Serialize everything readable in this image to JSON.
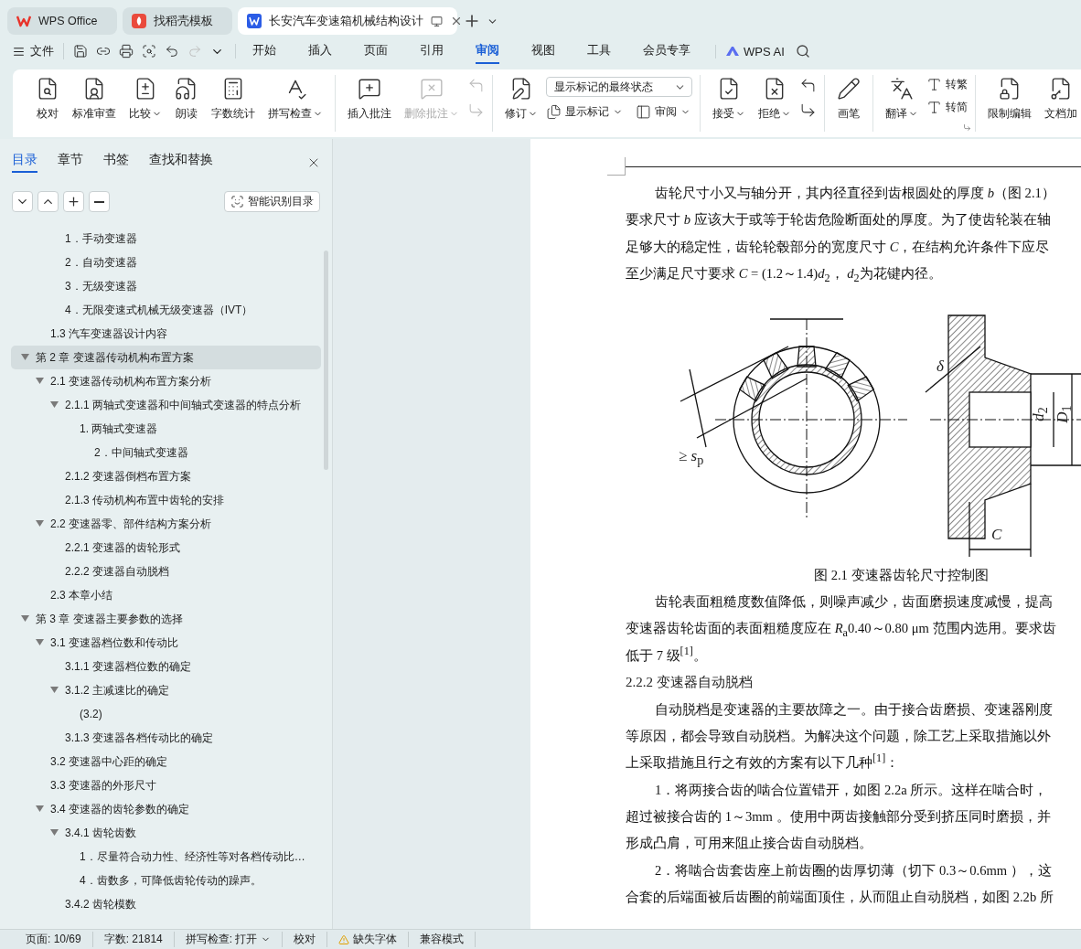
{
  "tabs": [
    {
      "label": "WPS Office",
      "selected": false,
      "kind": "wps"
    },
    {
      "label": "找稻壳模板",
      "selected": false,
      "kind": "docer"
    },
    {
      "label": "长安汽车变速箱机械结构设计",
      "selected": true,
      "kind": "doc"
    }
  ],
  "menu": {
    "file": "文件",
    "items": [
      {
        "label": "开始",
        "selected": false
      },
      {
        "label": "插入",
        "selected": false
      },
      {
        "label": "页面",
        "selected": false
      },
      {
        "label": "引用",
        "selected": false
      },
      {
        "label": "审阅",
        "selected": true
      },
      {
        "label": "视图",
        "selected": false
      },
      {
        "label": "工具",
        "selected": false
      },
      {
        "label": "会员专享",
        "selected": false
      }
    ],
    "ai": "WPS AI"
  },
  "ribbon": [
    {
      "items": [
        {
          "kind": "large",
          "label": "校对",
          "dropdown": false,
          "disabled": false
        },
        {
          "kind": "large",
          "label": "标准审查",
          "dropdown": false,
          "disabled": false
        },
        {
          "kind": "large",
          "label": "比较",
          "dropdown": true,
          "disabled": false
        },
        {
          "kind": "large",
          "label": "朗读",
          "dropdown": false,
          "disabled": false
        },
        {
          "kind": "large",
          "label": "字数统计",
          "dropdown": false,
          "disabled": false
        },
        {
          "kind": "large",
          "label": "拼写检查",
          "dropdown": true,
          "disabled": false
        }
      ]
    },
    {
      "items": [
        {
          "kind": "large",
          "label": "插入批注",
          "dropdown": false,
          "disabled": false
        },
        {
          "kind": "large",
          "label": "删除批注",
          "dropdown": true,
          "disabled": true
        },
        {
          "kind": "stack",
          "items": [
            {
              "kind": "icon",
              "disabled": true
            },
            {
              "kind": "icon",
              "disabled": true
            }
          ]
        }
      ]
    },
    {
      "items": [
        {
          "kind": "large",
          "label": "修订",
          "dropdown": true,
          "disabled": false
        },
        {
          "kind": "stack",
          "items": [
            {
              "kind": "select",
              "value": "显示标记的最终状态"
            },
            {
              "kind": "row",
              "items": [
                {
                  "kind": "small",
                  "label": "显示标记",
                  "dropdown": true,
                  "disabled": false
                },
                {
                  "kind": "small",
                  "label": "审阅",
                  "dropdown": true,
                  "disabled": false
                }
              ]
            }
          ]
        }
      ]
    },
    {
      "items": [
        {
          "kind": "large",
          "label": "接受",
          "dropdown": true,
          "disabled": false
        },
        {
          "kind": "large",
          "label": "拒绝",
          "dropdown": true,
          "disabled": false
        },
        {
          "kind": "stack",
          "items": [
            {
              "kind": "icon",
              "disabled": false
            },
            {
              "kind": "icon",
              "disabled": false
            }
          ]
        }
      ]
    },
    {
      "items": [
        {
          "kind": "large",
          "label": "画笔",
          "dropdown": false,
          "disabled": false
        }
      ]
    },
    {
      "launcher": true,
      "items": [
        {
          "kind": "large",
          "label": "翻译",
          "dropdown": true,
          "disabled": false
        },
        {
          "kind": "stack",
          "items": [
            {
              "kind": "small",
              "label": "转繁",
              "dropdown": false,
              "disabled": false
            },
            {
              "kind": "small",
              "label": "转简",
              "dropdown": false,
              "disabled": false
            }
          ]
        }
      ]
    },
    {
      "items": [
        {
          "kind": "large",
          "label": "限制编辑",
          "dropdown": false,
          "disabled": false
        },
        {
          "kind": "large",
          "label": "文档加",
          "dropdown": false,
          "disabled": false
        }
      ]
    }
  ],
  "sidebar": {
    "tabs": [
      {
        "label": "目录",
        "selected": true
      },
      {
        "label": "章节",
        "selected": false
      },
      {
        "label": "书签",
        "selected": false
      },
      {
        "label": "查找和替换",
        "selected": false
      }
    ],
    "smart_button": "智能识别目录",
    "toc": [
      {
        "children": [
          {
            "children": [
              {
                "label": "1．手动变速器",
                "selected": false
              },
              {
                "label": "2．自动变速器",
                "selected": false
              },
              {
                "label": "3．无级变速器",
                "selected": false
              },
              {
                "label": "4．无限变速式机械无级变速器（IVT）",
                "selected": false
              }
            ]
          },
          {
            "label": "1.3 汽车变速器设计内容",
            "selected": false
          }
        ]
      },
      {
        "label": "第 2 章  变速器传动机构布置方案",
        "selected": true,
        "expanded": true,
        "children": [
          {
            "label": "2.1 变速器传动机构布置方案分析",
            "selected": false,
            "expanded": true,
            "children": [
              {
                "label": "2.1.1 两轴式变速器和中间轴式变速器的特点分析",
                "selected": false,
                "expanded": true,
                "children": [
                  {
                    "label": "1. 两轴式变速器",
                    "selected": false,
                    "children": [
                      {
                        "label": "2．中间轴式变速器",
                        "selected": false
                      }
                    ]
                  }
                ]
              },
              {
                "label": "2.1.2 变速器倒档布置方案",
                "selected": false
              },
              {
                "label": "2.1.3 传动机构布置中齿轮的安排",
                "selected": false
              }
            ]
          },
          {
            "label": "2.2 变速器零、部件结构方案分析",
            "selected": false,
            "expanded": true,
            "children": [
              {
                "label": "2.2.1 变速器的齿轮形式",
                "selected": false
              },
              {
                "label": "2.2.2 变速器自动脱档",
                "selected": false
              }
            ]
          },
          {
            "label": "2.3 本章小结",
            "selected": false
          }
        ]
      },
      {
        "label": "第 3 章  变速器主要参数的选择",
        "selected": false,
        "expanded": true,
        "children": [
          {
            "label": "3.1 变速器档位数和传动比",
            "selected": false,
            "expanded": true,
            "children": [
              {
                "label": "3.1.1 变速器档位数的确定",
                "selected": false
              },
              {
                "label": "3.1.2 主减速比的确定",
                "selected": false,
                "expanded": true,
                "children": [
                  {
                    "label": "(3.2)",
                    "selected": false
                  }
                ]
              },
              {
                "label": "3.1.3  变速器各档传动比的确定",
                "selected": false
              }
            ]
          },
          {
            "label": "3.2 变速器中心距的确定",
            "selected": false
          },
          {
            "label": "3.3 变速器的外形尺寸",
            "selected": false
          },
          {
            "label": "3.4 变速器的齿轮参数的确定",
            "selected": false,
            "expanded": true,
            "children": [
              {
                "label": "3.4.1 齿轮齿数",
                "selected": false,
                "expanded": true,
                "children": [
                  {
                    "label": "1．尽量符合动力性、经济性等对各档传动比…",
                    "selected": false
                  },
                  {
                    "label": "4．齿数多，可降低齿轮传动的躁声。",
                    "selected": false
                  }
                ]
              },
              {
                "label": "3.4.2 齿轮模数",
                "selected": false
              }
            ]
          }
        ]
      }
    ]
  },
  "document": {
    "lines": [
      {
        "kind": "first",
        "text": "齿轮尺寸小又与轴分开，其内径直径到齿根圆处的厚度 *b*（图 2.1）"
      },
      {
        "kind": "cont",
        "text": "要求尺寸 *b* 应该大于或等于轮齿危险断面处的厚度。为了使齿轮装在轴"
      },
      {
        "kind": "cont",
        "text": "足够大的稳定性，齿轮轮毂部分的宽度尺寸 *C*，在结构允许条件下应尽"
      },
      {
        "kind": "cont",
        "text": "至少满足尺寸要求 *C* = (1.2～1.4)*d*$_{2}$，  *d*$_{2}$为花键内径。"
      },
      {
        "kind": "figure",
        "labels": [
          "≥ *s*$_{p}$",
          "*δ*",
          "*d*$_{2}$",
          "*D*$_{1}$",
          "*C*"
        ]
      },
      {
        "kind": "caption",
        "text": "图 2.1  变速器齿轮尺寸控制图"
      },
      {
        "kind": "first",
        "text": "齿轮表面粗糙度数值降低，则噪声减少，齿面磨损速度减慢，提高"
      },
      {
        "kind": "cont",
        "text": "变速器齿轮齿面的表面粗糙度应在 *R*$_{a}$0.40～0.80 μm 范围内选用。要求齿"
      },
      {
        "kind": "cont",
        "text": "低于 7 级$^{[1]}$。"
      },
      {
        "kind": "heading",
        "text": "2.2.2 变速器自动脱档"
      },
      {
        "kind": "first",
        "text": "自动脱档是变速器的主要故障之一。由于接合齿磨损、变速器刚度"
      },
      {
        "kind": "cont",
        "text": "等原因，都会导致自动脱档。为解决这个问题，除工艺上采取措施以外"
      },
      {
        "kind": "cont",
        "text": "上采取措施且行之有效的方案有以下几种$^{[1]}$："
      },
      {
        "kind": "first",
        "text": "1．将两接合齿的啮合位置错开，如图 2.2a 所示。这样在啮合时，"
      },
      {
        "kind": "cont",
        "text": "超过被接合齿的 1～3mm 。使用中两齿接触部分受到挤压同时磨损，并"
      },
      {
        "kind": "cont",
        "text": "形成凸肩，可用来阻止接合齿自动脱档。"
      },
      {
        "kind": "first",
        "text": "2．将啮合齿套齿座上前齿圈的齿厚切薄（切下 0.3～0.6mm ），这"
      },
      {
        "kind": "cont",
        "text": "合套的后端面被后齿圈的前端面顶住，从而阻止自动脱档，如图 2.2b 所"
      }
    ]
  },
  "status_bar": [
    {
      "kind": "text",
      "label": "页面: 10/69"
    },
    {
      "kind": "text",
      "label": "字数: 21814"
    },
    {
      "kind": "dropdown",
      "label": "拼写检查: 打开"
    },
    {
      "kind": "text",
      "label": "校对"
    },
    {
      "kind": "warning",
      "label": "缺失字体"
    },
    {
      "kind": "text",
      "label": "兼容模式"
    }
  ]
}
